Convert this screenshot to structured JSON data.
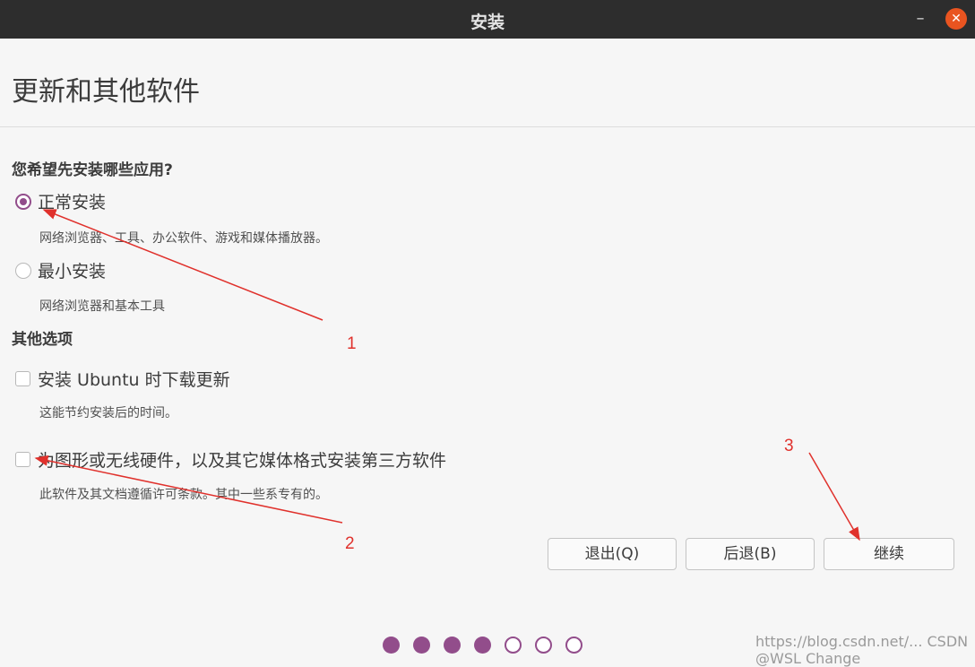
{
  "window": {
    "title": "安装",
    "minimize_glyph": "–",
    "close_glyph": "✕"
  },
  "page": {
    "title": "更新和其他软件"
  },
  "install_type": {
    "question": "您希望先安装哪些应用?",
    "options": [
      {
        "label": "正常安装",
        "description": "网络浏览器、工具、办公软件、游戏和媒体播放器。",
        "selected": true
      },
      {
        "label": "最小安装",
        "description": "网络浏览器和基本工具",
        "selected": false
      }
    ]
  },
  "other_options": {
    "heading": "其他选项",
    "items": [
      {
        "label": "安装 Ubuntu 时下载更新",
        "description": "这能节约安装后的时间。",
        "checked": false
      },
      {
        "label": "为图形或无线硬件，以及其它媒体格式安装第三方软件",
        "description": "此软件及其文档遵循许可条款。其中一些系专有的。",
        "checked": false
      }
    ]
  },
  "buttons": {
    "quit": "退出(Q)",
    "back": "后退(B)",
    "continue": "继续"
  },
  "progress": {
    "total_steps": 7,
    "completed_steps": 4
  },
  "annotations": {
    "label_1": "1",
    "label_2": "2",
    "label_3": "3"
  },
  "watermark": "https://blog.csdn.net/... CSDN @WSL Change",
  "colors": {
    "accent": "#924d8b",
    "titlebar": "#2d2d2d",
    "close_button": "#e95420",
    "annotation": "#e0312c"
  }
}
